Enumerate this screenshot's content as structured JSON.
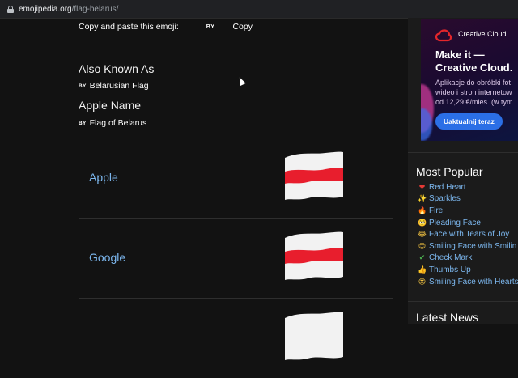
{
  "browser": {
    "host": "emojipedia.org",
    "path": "/flag-belarus/"
  },
  "copy_section": {
    "label": "Copy and paste this emoji:",
    "by_badge": "BY",
    "copy_label": "Copy"
  },
  "also_known_as": {
    "title": "Also Known As",
    "tag": "BY",
    "value": "Belarusian Flag"
  },
  "apple_name": {
    "title": "Apple Name",
    "tag": "BY",
    "value": "Flag of Belarus"
  },
  "vendors": [
    {
      "name": "Apple",
      "image": "flag-belarus-icon"
    },
    {
      "name": "Google",
      "image": "flag-belarus-icon"
    }
  ],
  "ad": {
    "brand": "Creative Cloud",
    "headline_line1": "Make it —",
    "headline_line2": "Creative Cloud.",
    "body_line1": "Aplikacje do obróbki fot",
    "body_line2": "wideo i stron internetow",
    "body_line3": "od 12,29 €/mies. (w tym",
    "button": "Uaktualnij teraz",
    "colors": {
      "logo": "#e3262b",
      "button": "#2b6fe6"
    }
  },
  "most_popular": {
    "title": "Most Popular",
    "items": [
      {
        "icon": "❤",
        "icon_name": "red-heart-icon",
        "label": "Red Heart"
      },
      {
        "icon": "✨",
        "icon_name": "sparkles-icon",
        "label": "Sparkles"
      },
      {
        "icon": "🔥",
        "icon_name": "fire-icon",
        "label": "Fire"
      },
      {
        "icon": "🥺",
        "icon_name": "pleading-face-icon",
        "label": "Pleading Face"
      },
      {
        "icon": "😂",
        "icon_name": "face-with-tears-of-joy-icon",
        "label": "Face with Tears of Joy"
      },
      {
        "icon": "😊",
        "icon_name": "smiling-face-with-smiling-eyes-icon",
        "label": "Smiling Face with Smilin"
      },
      {
        "icon": "✔",
        "icon_name": "check-mark-icon",
        "label": "Check Mark"
      },
      {
        "icon": "👍",
        "icon_name": "thumbs-up-icon",
        "label": "Thumbs Up"
      },
      {
        "icon": "😍",
        "icon_name": "smiling-face-with-heart-eyes-icon",
        "label": "Smiling Face with Hearts"
      }
    ]
  },
  "latest_news": {
    "title": "Latest News"
  },
  "colors": {
    "background": "#121212",
    "link": "#7cb7ee",
    "flag_red": "#e81e2d",
    "flag_white": "#ffffff"
  }
}
